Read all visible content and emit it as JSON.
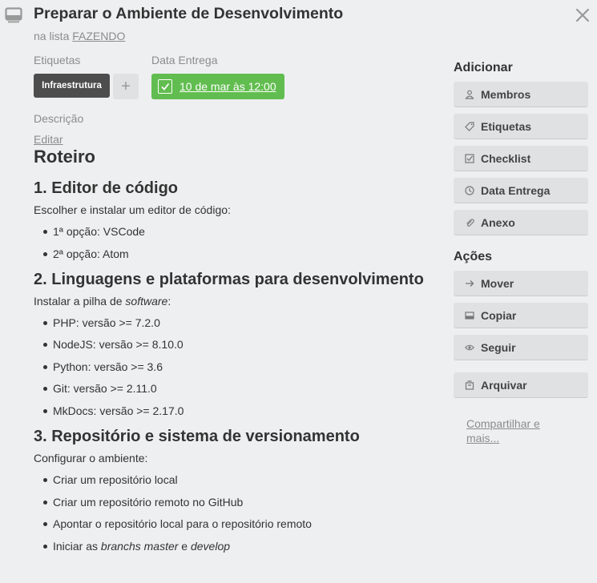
{
  "card": {
    "title": "Preparar o Ambiente de Desenvolvimento",
    "in_list_prefix": "na lista",
    "list_name": "FAZENDO"
  },
  "labels": {
    "heading": "Etiquetas",
    "items": [
      "Infraestrutura"
    ],
    "add_symbol": "+"
  },
  "due": {
    "heading": "Data Entrega",
    "value": "10 de mar às 12:00",
    "color": "#61bd4f"
  },
  "description": {
    "heading": "Descrição",
    "edit_label": "Editar",
    "title": "Roteiro",
    "sections": [
      {
        "heading": "1. Editor de código",
        "intro": "Escolher e instalar um editor de código:",
        "items": [
          "1ª opção: VSCode",
          "2ª opção: Atom"
        ]
      },
      {
        "heading": "2. Linguagens e plataformas para desenvolvimento",
        "intro_before": "Instalar a pilha de ",
        "intro_em": "software",
        "intro_after": ":",
        "items": [
          "PHP: versão >= 7.2.0",
          "NodeJS: versão >= 8.10.0",
          "Python: versão >= 3.6",
          "Git: versão >= 2.11.0",
          "MkDocs: versão >= 2.17.0"
        ]
      },
      {
        "heading": "3. Repositório e sistema de versionamento",
        "intro": "Configurar o ambiente:",
        "items": [
          "Criar um repositório local",
          "Criar um repositório remoto no GitHub",
          "Apontar o repositório local para o repositório remoto"
        ],
        "last_item": {
          "before": "Iniciar as ",
          "em1": "branchs master",
          "mid": " e ",
          "em2": "develop"
        }
      }
    ]
  },
  "sidebar": {
    "add_heading": "Adicionar",
    "add_buttons": [
      {
        "label": "Membros",
        "icon": "person-icon"
      },
      {
        "label": "Etiquetas",
        "icon": "tag-icon"
      },
      {
        "label": "Checklist",
        "icon": "checkbox-icon"
      },
      {
        "label": "Data Entrega",
        "icon": "clock-icon"
      },
      {
        "label": "Anexo",
        "icon": "paperclip-icon"
      }
    ],
    "actions_heading": "Ações",
    "action_buttons": [
      {
        "label": "Mover",
        "icon": "arrow-right-icon"
      },
      {
        "label": "Copiar",
        "icon": "copy-icon"
      },
      {
        "label": "Seguir",
        "icon": "eye-icon"
      },
      {
        "label": "Arquivar",
        "icon": "archive-icon"
      }
    ],
    "share_label": "Compartilhar e mais..."
  }
}
